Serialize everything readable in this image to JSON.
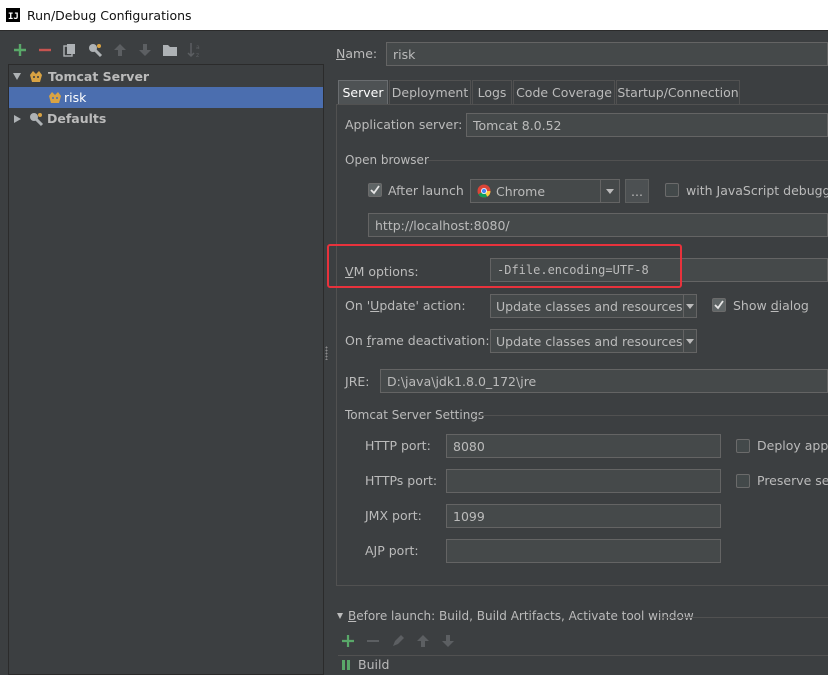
{
  "window": {
    "title": "Run/Debug Configurations"
  },
  "toolbar": {
    "icons": [
      "add-icon",
      "remove-icon",
      "copy-icon",
      "wrench-icon",
      "arrow-up-icon",
      "arrow-down-icon",
      "folder-icon",
      "sort-icon"
    ],
    "add_color": "#59a869",
    "remove_color": "#c75450"
  },
  "tree": {
    "tomcat_server": "Tomcat Server",
    "risk": "risk",
    "defaults": "Defaults"
  },
  "name": {
    "label": "Name:",
    "value": "risk"
  },
  "tabs": [
    {
      "label": "Server",
      "active": true
    },
    {
      "label": "Deployment"
    },
    {
      "label": "Logs"
    },
    {
      "label": "Code Coverage"
    },
    {
      "label": "Startup/Connection"
    }
  ],
  "server": {
    "app_server_label": "Application server:",
    "app_server_value": "Tomcat 8.0.52",
    "open_browser_label": "Open browser",
    "after_launch_label": "After launch",
    "after_launch_checked": true,
    "browser": "Chrome",
    "ellipsis": "...",
    "with_js_debugger": "with JavaScript debugge",
    "url": "http://localhost:8080/",
    "vm_options_label": "VM options:",
    "vm_options_value": "-Dfile.encoding=UTF-8",
    "highlight_color": "#e8323c",
    "on_update_label": "On 'Update' action:",
    "on_update_value": "Update classes and resources",
    "show_dialog_label": "Show dialog",
    "show_dialog_checked": true,
    "on_frame_label": "On frame deactivation:",
    "on_frame_value": "Update classes and resources",
    "jre_label": "JRE:",
    "jre_value": "D:\\java\\jdk1.8.0_172\\jre"
  },
  "tomcat_settings": {
    "title": "Tomcat Server Settings",
    "http_port_label": "HTTP port:",
    "http_port_value": "8080",
    "https_port_label": "HTTPs port:",
    "https_port_value": "",
    "jmx_port_label": "JMX port:",
    "jmx_port_value": "1099",
    "ajp_port_label": "AJP port:",
    "ajp_port_value": "",
    "deploy_label": "Deploy appl",
    "preserve_label": "Preserve ses"
  },
  "before_launch": {
    "title": "Before launch: Build, Build Artifacts, Activate tool window",
    "build_item": "Build"
  }
}
